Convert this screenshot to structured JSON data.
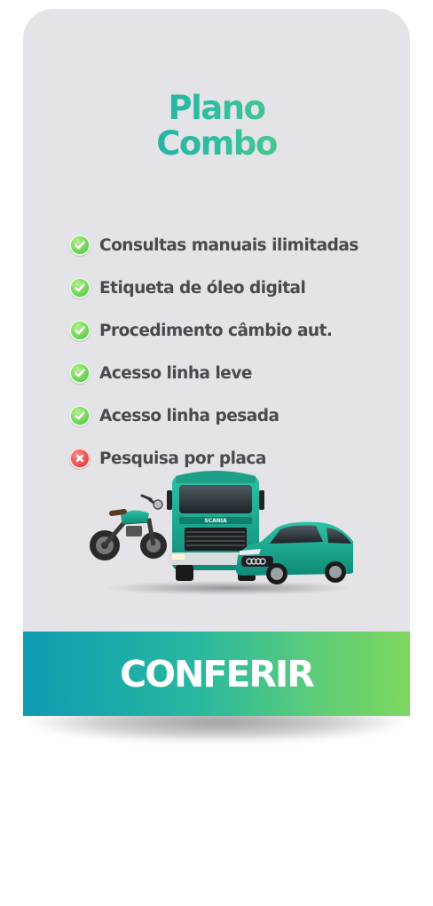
{
  "plan": {
    "title_line1": "Plano",
    "title_line2": "Combo"
  },
  "features": [
    {
      "label": "Consultas manuais ilimitadas",
      "included": true,
      "icon": "check-icon"
    },
    {
      "label": "Etiqueta de óleo digital",
      "included": true,
      "icon": "check-icon"
    },
    {
      "label": "Procedimento câmbio aut.",
      "included": true,
      "icon": "check-icon"
    },
    {
      "label": "Acesso linha leve",
      "included": true,
      "icon": "check-icon"
    },
    {
      "label": "Acesso linha pesada",
      "included": true,
      "icon": "check-icon"
    },
    {
      "label": "Pesquisa por placa",
      "included": false,
      "icon": "cross-icon"
    }
  ],
  "vehicles_image": {
    "truck_brand": "SCANIA",
    "icons": [
      "motorcycle-icon",
      "truck-icon",
      "car-icon"
    ]
  },
  "cta": {
    "label": "CONFERIR"
  },
  "colors": {
    "card_bg": "#e4e3e8",
    "brand_teal": "#109fae",
    "brand_green": "#7dd86b",
    "vehicle_teal": "#17a58c",
    "check_green": "#6cd25a",
    "cross_red": "#ec4a4a",
    "feature_text": "#4a4a4e"
  }
}
